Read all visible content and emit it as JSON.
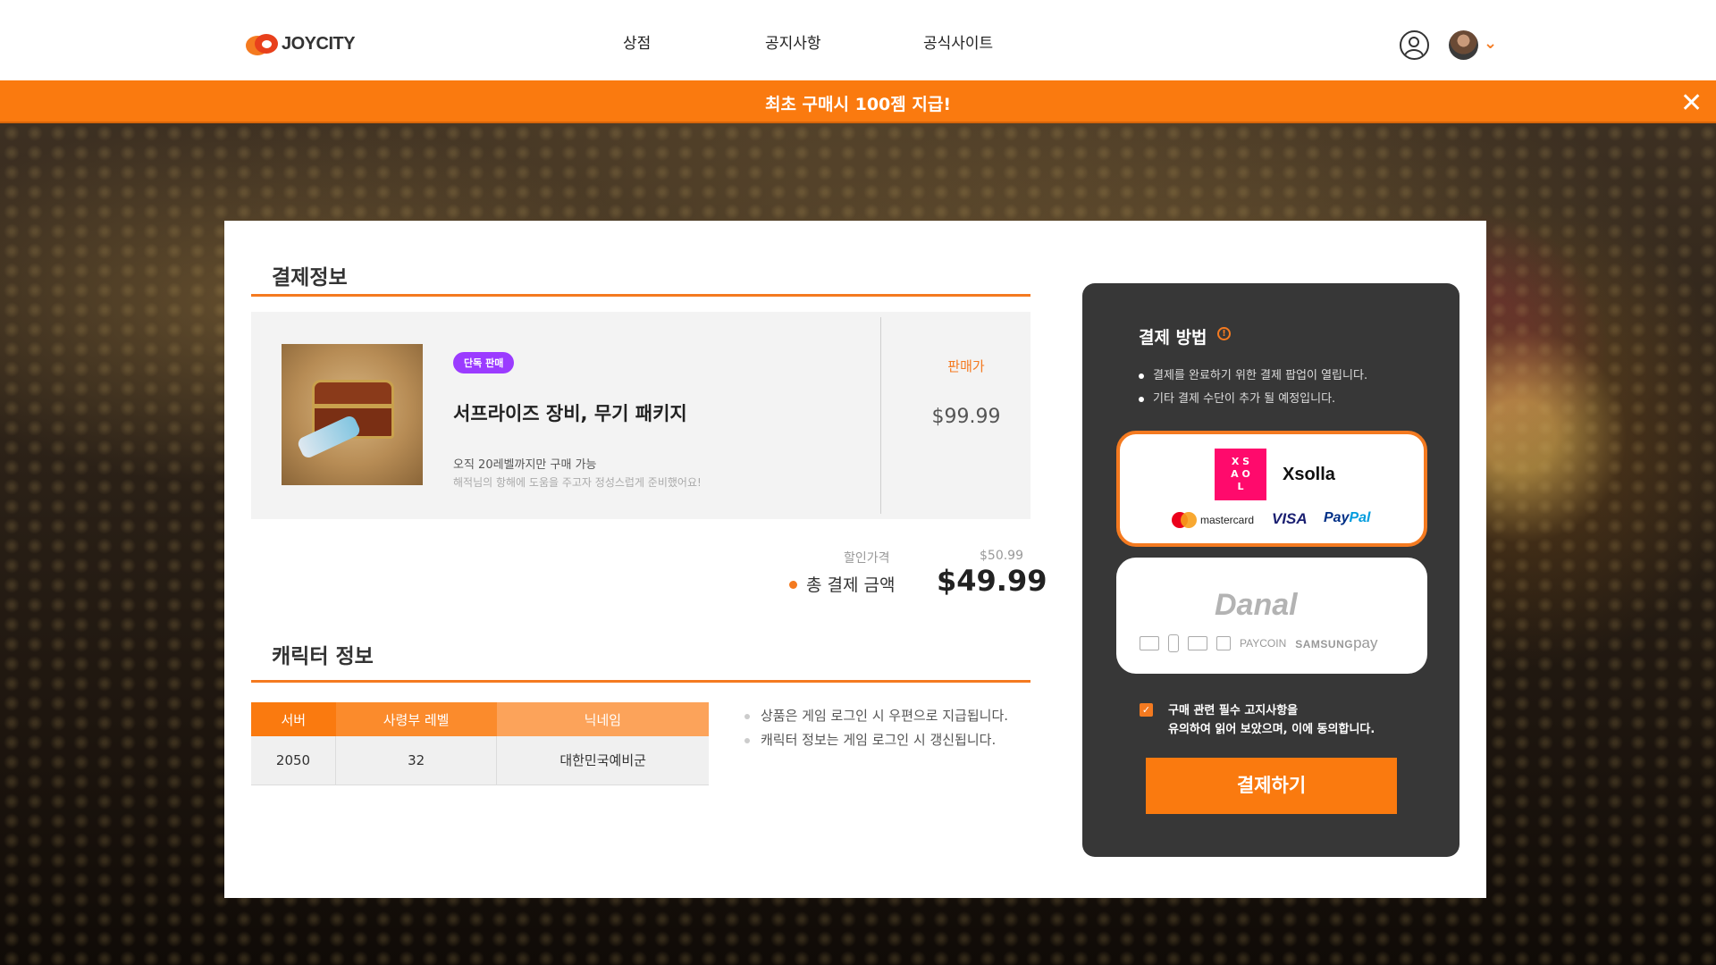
{
  "header": {
    "logo_text": "JOYCITY",
    "nav": {
      "shop": "상점",
      "notice": "공지사항",
      "official": "공식사이트"
    },
    "chevron": "⌄"
  },
  "banner": {
    "text": "최초 구매시 100젬 지급!",
    "close": "✕"
  },
  "payment_info": {
    "title": "결제정보",
    "product": {
      "badge": "단독 판매",
      "name": "서프라이즈 장비, 무기 패키지",
      "note_limit": "오직 20레벨까지만 구매 가능",
      "note_desc": "해적님의 항해에 도움을 주고자 정성스럽게 준비했어요!",
      "price_label": "판매가",
      "price": "$99.99"
    },
    "discount_label": "할인가격",
    "discount_value": "$50.99",
    "total_label": "총 결제 금액",
    "total_value": "$49.99"
  },
  "character_info": {
    "title": "캐릭터 정보",
    "headers": [
      "서버",
      "사령부 레벨",
      "닉네임"
    ],
    "row": [
      "2050",
      "32",
      "대한민국예비군"
    ],
    "notes": [
      "상품은 게임 로그인 시 우편으로 지급됩니다.",
      "캐릭터 정보는 게임 로그인 시 갱신됩니다."
    ]
  },
  "payment_method": {
    "title": "결제 방법",
    "info_icon": "!",
    "notes": [
      "결제를 완료하기 위한 결제 팝업이 열립니다.",
      "기타 결제 수단이 추가 될 예정입니다."
    ],
    "xsolla": {
      "name": "Xsolla",
      "logo_glyph": "X S\nA O\nL",
      "mastercard": "mastercard",
      "visa": "VISA",
      "paypal_a": "Pay",
      "paypal_b": "Pal"
    },
    "danal": {
      "name": "Danal",
      "paycoin": "PAYCOIN",
      "samsung": "SAMSUNG",
      "samsung_pay": "pay"
    },
    "agree_check": "✓",
    "agree_line1": "구매 관련 필수 고지사항을",
    "agree_line2": "유의하여 읽어 보았으며, 이에 동의합니다.",
    "pay_button": "결제하기"
  },
  "colors": {
    "accent": "#fa7a0f",
    "badge": "#9b3bff",
    "xsolla": "#ff0a6c"
  }
}
